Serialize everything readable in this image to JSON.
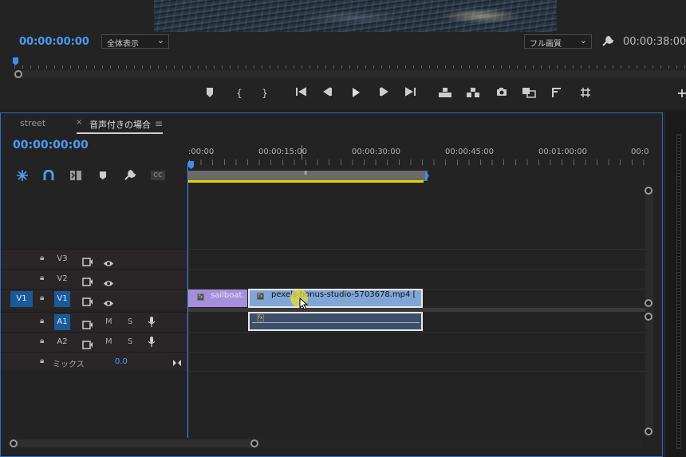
{
  "monitor": {
    "current_timecode": "00:00:00:00",
    "zoom_dropdown": "全体表示",
    "quality_dropdown": "フル画質",
    "duration_timecode": "00:00:38:00",
    "transport_icons": [
      "add-marker-icon",
      "mark-in-icon",
      "mark-out-icon",
      "go-to-in-icon",
      "step-back-icon",
      "play-icon",
      "step-forward-icon",
      "go-to-out-icon",
      "lift-icon",
      "extract-icon",
      "export-frame-icon",
      "comparison-view-icon",
      "trim-icon",
      "safe-margins-icon",
      "add-button-icon"
    ]
  },
  "timeline": {
    "tabs": [
      {
        "label": "street"
      },
      {
        "label": "音声付きの場合"
      }
    ],
    "tab_close": "×",
    "panel_menu": "≡",
    "current_timecode": "00:00:00:00",
    "ruler_labels": [
      ":00:00",
      "00:00:15:00",
      "00:00:30:00",
      "00:00:45:00",
      "00:01:00:00",
      "00:0"
    ],
    "tools": [
      "snap-icon",
      "linked-selection-icon",
      "add-edit-icon",
      "add-marker-icon",
      "settings-wrench-icon",
      "captions-icon"
    ],
    "tools_cc_label": "CC",
    "work_area_handle": "III",
    "tracks": {
      "v3": {
        "label": "V3"
      },
      "v2": {
        "label": "V2"
      },
      "v1": {
        "label": "V1",
        "source": "V1"
      },
      "a1": {
        "label": "A1",
        "mute": "M",
        "solo": "S"
      },
      "a2": {
        "label": "A2",
        "mute": "M",
        "solo": "S"
      },
      "mix": {
        "label": "ミックス",
        "value": "0.0"
      }
    },
    "clips": {
      "clip1_name": "sailboat.",
      "clip2_name": "pexels-bonus-studio-5703678.mp4 [",
      "fx_label": "fx"
    }
  },
  "colors": {
    "accent_blue": "#4b9cf5",
    "clip_purple": "#a48fdc",
    "clip_blue": "#7fa6d6",
    "audio_clip": "#3e5069",
    "work_area_yellow": "#e8d400"
  }
}
